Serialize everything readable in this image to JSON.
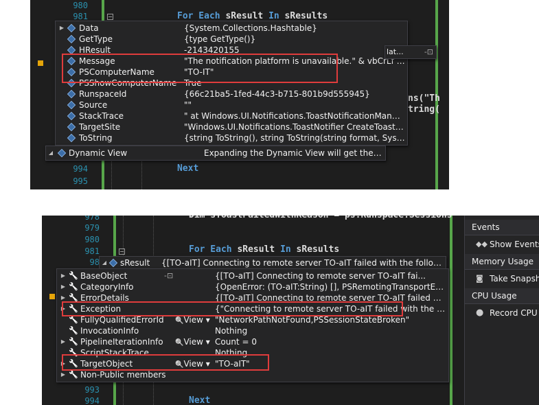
{
  "top": {
    "line_numbers_top": [
      "980",
      "981"
    ],
    "line_numbers_bottom": [
      "994",
      "995"
    ],
    "code_for_each": {
      "kw1": "For Each",
      "var1": " sResult ",
      "kw2": "In",
      "var2": " sResults"
    },
    "code_next": "Next",
    "code_right1": "ns(\"Th",
    "code_right2": "tring(",
    "code_right3": "lat...",
    "rows": [
      {
        "name": "Data",
        "value": "{System.Collections.Hashtable}",
        "arrow": "▶"
      },
      {
        "name": "GetType",
        "value": "{type GetType()}",
        "arrow": ""
      },
      {
        "name": "HResult",
        "value": "-2143420155",
        "arrow": ""
      },
      {
        "name": "Message",
        "value": "\"The notification platform is unavailable.\" & vbCrLf & vbCrL...",
        "arrow": ""
      },
      {
        "name": "PSComputerName",
        "value": "\"TO-IT\"",
        "arrow": ""
      },
      {
        "name": "PSShowComputerName",
        "value": "True",
        "arrow": ""
      },
      {
        "name": "RunspaceId",
        "value": "{66c21ba5-1fed-44c3-b715-801b9d555945}",
        "arrow": ""
      },
      {
        "name": "Source",
        "value": "\"\"",
        "arrow": ""
      },
      {
        "name": "StackTrace",
        "value": "\"   at Windows.UI.Notifications.ToastNotificationManager.Cr...",
        "arrow": ""
      },
      {
        "name": "TargetSite",
        "value": "\"Windows.UI.Notifications.ToastNotifier CreateToastNotifier...",
        "arrow": ""
      },
      {
        "name": "ToString",
        "value": "{string ToString(), string ToString(string format, System.IFor...",
        "arrow": ""
      }
    ],
    "dynamic_view": {
      "name": "Dynamic View",
      "value": "Expanding the Dynamic View will get the dynam...",
      "arrow": "◢"
    }
  },
  "bottom": {
    "line_numbers": [
      "978",
      "979",
      "980",
      "981",
      "98"
    ],
    "line_numbers_bottom": [
      "993",
      "994"
    ],
    "code_dim": "Dim sToastFailedWithReason = ps.Runspace.Sessions",
    "code_for_each": {
      "kw1": "For Each",
      "var1": " sResult ",
      "kw2": "In",
      "var2": " sResults"
    },
    "code_next": "Next",
    "header": {
      "name": "sResult",
      "value": "{[TO-aIT] Connecting to remote server TO-aIT failed with the following erro...",
      "arrow": "◢"
    },
    "view_label": "View",
    "rows": [
      {
        "name": "BaseObject",
        "value": "{[TO-aIT] Connecting to remote server TO-aIT fai...",
        "arrow": "▶",
        "view": false
      },
      {
        "name": "CategoryInfo",
        "value": "{OpenError: (TO-aIT:String) [], PSRemotingTransportException}",
        "arrow": "▶",
        "view": false
      },
      {
        "name": "ErrorDetails",
        "value": "{[TO-aIT] Connecting to remote server TO-aIT failed with the fo...",
        "arrow": "▶",
        "view": false
      },
      {
        "name": "Exception",
        "value": "{\"Connecting to remote server TO-aIT failed with the following...",
        "arrow": "▶",
        "view": false
      },
      {
        "name": "FullyQualifiedErrorId",
        "value": "\"NetworkPathNotFound,PSSessionStateBroken\"",
        "arrow": "",
        "view": true
      },
      {
        "name": "InvocationInfo",
        "value": "Nothing",
        "arrow": "",
        "view": false
      },
      {
        "name": "PipelineIterationInfo",
        "value": "Count = 0",
        "arrow": "▶",
        "view": true
      },
      {
        "name": "ScriptStackTrace",
        "value": "Nothing",
        "arrow": "",
        "view": false
      },
      {
        "name": "TargetObject",
        "value": "\"TO-aIT\"",
        "arrow": "▶",
        "view": true
      },
      {
        "name": "Non-Public members",
        "value": "",
        "arrow": "▶",
        "view": false
      }
    ]
  },
  "diagnostics": {
    "events_header": "Events",
    "show_events": "Show Events (",
    "memory_header": "Memory Usage",
    "take_snapshot": "Take Snapsho",
    "cpu_header": "CPU Usage",
    "record_cpu": "Record CPU P"
  },
  "colors": {
    "keyword": "#569cd6",
    "line_number": "#2b91af",
    "highlight_box": "#e03c3c",
    "change_bar": "#57a64a"
  }
}
